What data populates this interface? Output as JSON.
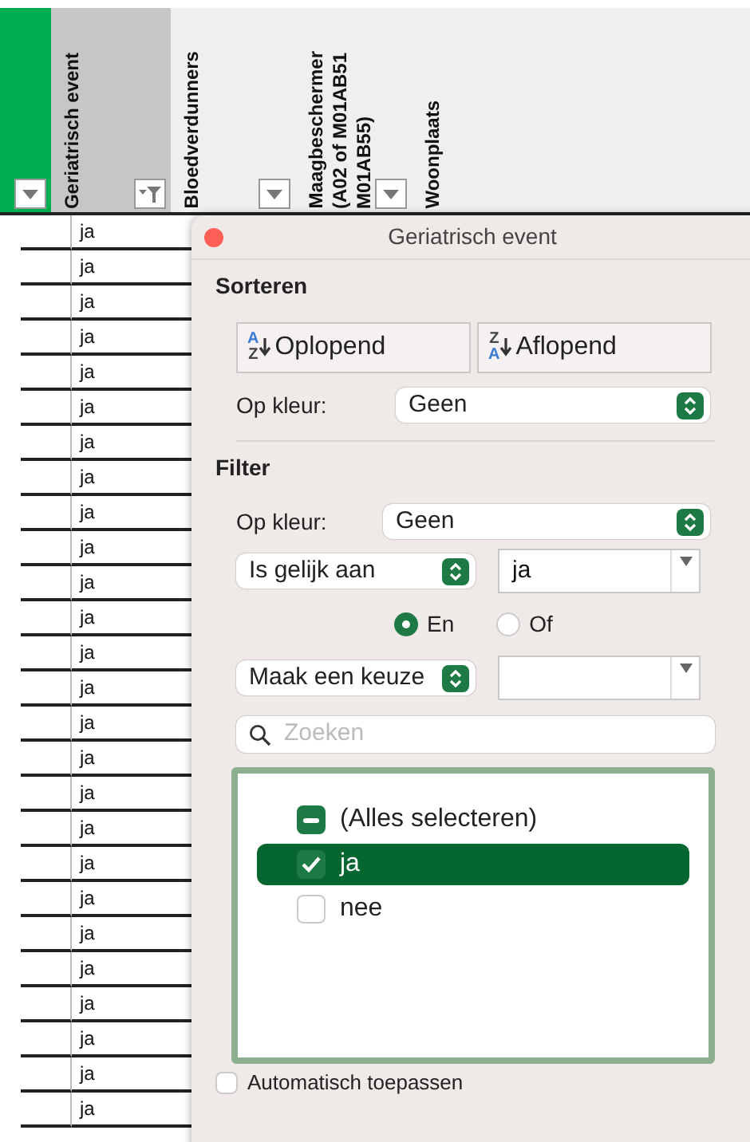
{
  "sheet": {
    "columns": [
      {
        "color": "#00b050",
        "filter_applied": false
      },
      {
        "lines": [
          "Geriatrisch event"
        ],
        "color": "#c6c6c6",
        "filter_applied": true
      },
      {
        "lines": [
          "Bloedverdunners"
        ],
        "filter_applied": false
      },
      {
        "lines": [
          "Maagbeschermer",
          "(A02 of M01AB51",
          "M01AB55)"
        ],
        "filter_applied": false
      },
      {
        "lines": [
          "Woonplaats"
        ]
      }
    ],
    "rows": [
      "ja",
      "ja",
      "ja",
      "ja",
      "ja",
      "ja",
      "ja",
      "ja",
      "ja",
      "ja",
      "ja",
      "ja",
      "ja",
      "ja",
      "ja",
      "ja",
      "ja",
      "ja",
      "ja",
      "ja",
      "ja",
      "ja",
      "ja",
      "ja",
      "ja",
      "ja"
    ]
  },
  "filter_popup": {
    "title": "Geriatrisch event",
    "sort": {
      "heading": "Sorteren",
      "buttons": [
        {
          "kind": "ascending",
          "icon_top": "A",
          "icon_bottom": "Z",
          "label": "Oplopend"
        },
        {
          "kind": "descending",
          "icon_top": "Z",
          "icon_bottom": "A",
          "label": "Aflopend"
        }
      ],
      "color_label": "Op kleur:",
      "color_value": "Geen"
    },
    "filter": {
      "heading": "Filter",
      "color_label": "Op kleur:",
      "color_value": "Geen",
      "condition_1": {
        "operator": "Is gelijk aan",
        "value": "ja"
      },
      "logic": [
        {
          "label": "En",
          "selected": true
        },
        {
          "label": "Of",
          "selected": false
        }
      ],
      "condition_2": {
        "operator": "Maak een keuze"
      },
      "search": {
        "placeholder": "Zoeken"
      },
      "values": [
        {
          "label": "(Alles selecteren)",
          "mixed": true,
          "selected": false
        },
        {
          "label": "ja",
          "checked": true,
          "selected": true
        },
        {
          "label": "nee",
          "checked": false,
          "selected": false
        }
      ],
      "auto_apply": {
        "label": "Automatisch toepassen",
        "checked": false
      }
    }
  }
}
